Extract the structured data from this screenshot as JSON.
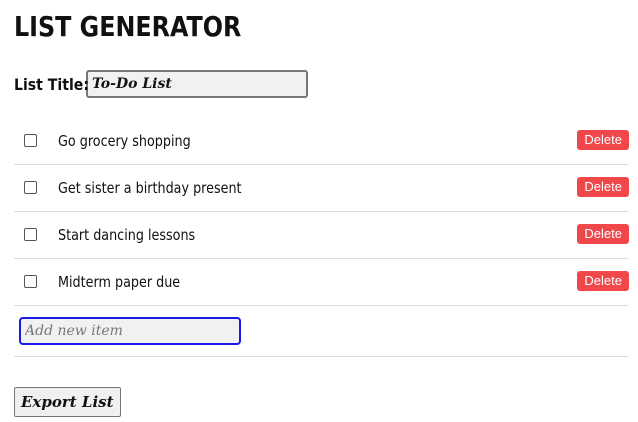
{
  "app": {
    "title": "LIST GENERATOR"
  },
  "list_title": {
    "label": "List Title:",
    "value": "To-Do List"
  },
  "items": [
    {
      "text": "Go grocery shopping",
      "checked": false,
      "delete_label": "Delete"
    },
    {
      "text": "Get sister a birthday present",
      "checked": false,
      "delete_label": "Delete"
    },
    {
      "text": "Start dancing lessons",
      "checked": false,
      "delete_label": "Delete"
    },
    {
      "text": "Midterm paper due",
      "checked": false,
      "delete_label": "Delete"
    }
  ],
  "new_item": {
    "placeholder": "Add new item",
    "value": ""
  },
  "export": {
    "label": "Export List"
  },
  "colors": {
    "delete_button": "#f0474b",
    "focus_border": "#1a1ae6"
  }
}
